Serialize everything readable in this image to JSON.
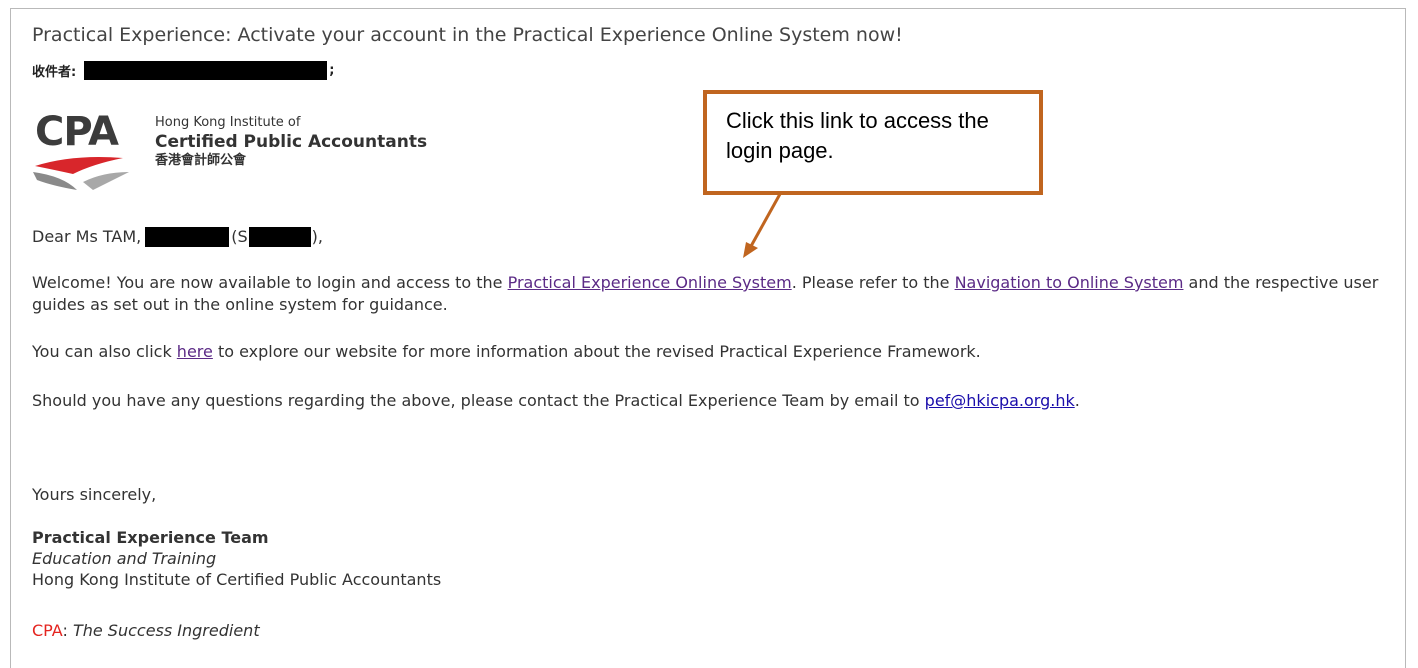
{
  "email": {
    "subject": "Practical Experience: Activate your account in the Practical Experience Online System now!",
    "recipient_label": "收件者:",
    "recipient_suffix": ";",
    "logo": {
      "acronym": "CPA",
      "line1": "Hong Kong Institute of",
      "line2": "Certified Public Accountants",
      "line3": "香港會計師公會"
    },
    "greeting": {
      "prefix": "Dear Ms TAM,",
      "mid": "(S",
      "suffix": "),"
    },
    "welcome": {
      "part1": "Welcome! You are now available to login and access to the ",
      "link1": "Practical Experience Online System",
      "part2": ". Please refer to the ",
      "link2": "Navigation to Online System",
      "part3": " and the respective user guides as set out in the online system for guidance."
    },
    "explore": {
      "part1": "You can also click ",
      "link": "here",
      "part2": " to explore our website for more information about the revised Practical Experience Framework."
    },
    "contact": {
      "part1": "Should you have any questions regarding the above, please contact the Practical Experience Team by email to ",
      "email_link": "pef@hkicpa.org.hk",
      "part2": "."
    },
    "closing": "Yours sincerely,",
    "signature": {
      "team": "Practical Experience Team",
      "dept": "Education and Training",
      "org": "Hong Kong Institute of Certified Public Accountants"
    },
    "tagline": {
      "brand": "CPA",
      "sep": ": ",
      "slogan": "The Success Ingredient"
    }
  },
  "callout": {
    "text": "Click this link to access the login page."
  },
  "colors": {
    "callout_border": "#c0651f",
    "visited_link": "#5b2a86",
    "link": "#1a0dab",
    "brand_red": "#e4241f"
  }
}
